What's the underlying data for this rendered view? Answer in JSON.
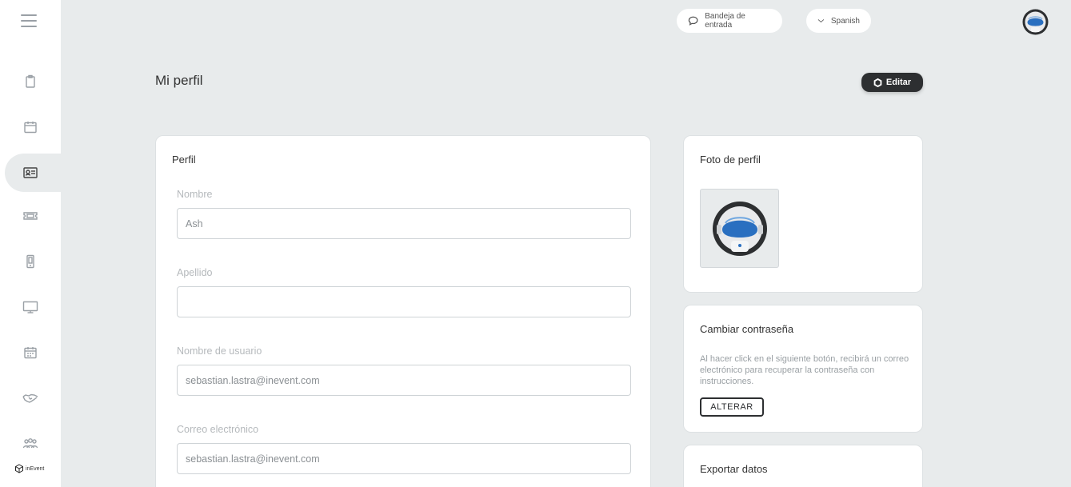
{
  "topbar": {
    "inbox_label": "Bandeja de entrada",
    "language_label": "Spanish"
  },
  "sidebar": {
    "items": [
      {
        "icon": "clipboard-icon"
      },
      {
        "icon": "calendar-icon"
      },
      {
        "icon": "id-card-icon",
        "active": true
      },
      {
        "icon": "ticket-icon"
      },
      {
        "icon": "mobile-icon"
      },
      {
        "icon": "monitor-icon"
      },
      {
        "icon": "schedule-icon"
      },
      {
        "icon": "handshake-icon"
      },
      {
        "icon": "group-icon"
      }
    ],
    "brand": "inEvent"
  },
  "page": {
    "title": "Mi perfil",
    "edit_label": "Editar"
  },
  "profile": {
    "title": "Perfil",
    "fields": [
      {
        "label": "Nombre",
        "value": "Ash"
      },
      {
        "label": "Apellido",
        "value": ""
      },
      {
        "label": "Nombre de usuario",
        "value": "sebastian.lastra@inevent.com"
      },
      {
        "label": "Correo electrónico",
        "value": "sebastian.lastra@inevent.com"
      }
    ]
  },
  "photo": {
    "title": "Foto de perfil"
  },
  "password": {
    "title": "Cambiar contraseña",
    "description": "Al hacer click en el siguiente botón, recibirá un correo electrónico para recuperar la contraseña con instrucciones.",
    "button_label": "ALTERAR"
  },
  "export": {
    "title": "Exportar datos"
  },
  "colors": {
    "background": "#e8ebec",
    "dark_button": "#2d2f31",
    "avatar_blue": "#2a6fc0"
  }
}
